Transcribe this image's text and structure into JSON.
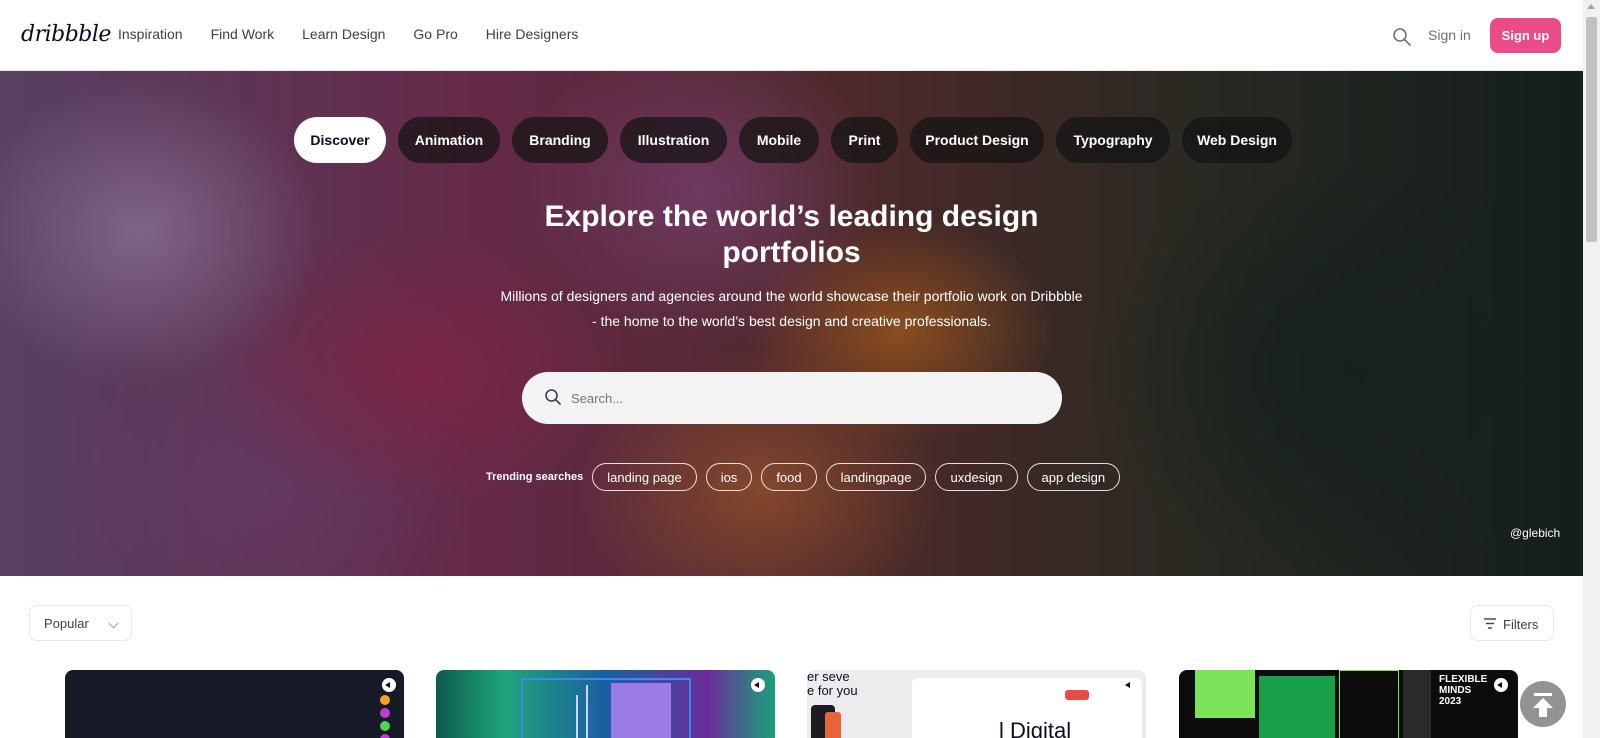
{
  "nav": {
    "logo": "dribbble",
    "links": [
      "Inspiration",
      "Find Work",
      "Learn Design",
      "Go Pro",
      "Hire Designers"
    ],
    "search_icon": "search-icon",
    "signin_label": "Sign in",
    "signup_label": "Sign up",
    "accent": "#ea4c89"
  },
  "hero": {
    "categories": [
      {
        "label": "Discover",
        "active": true
      },
      {
        "label": "Animation",
        "active": false
      },
      {
        "label": "Branding",
        "active": false
      },
      {
        "label": "Illustration",
        "active": false
      },
      {
        "label": "Mobile",
        "active": false
      },
      {
        "label": "Print",
        "active": false
      },
      {
        "label": "Product Design",
        "active": false
      },
      {
        "label": "Typography",
        "active": false
      },
      {
        "label": "Web Design",
        "active": false
      }
    ],
    "title_line1": "Explore the world’s leading design",
    "title_line2": "portfolios",
    "subtitle": "Millions of designers and agencies around the world showcase their portfolio work on Dribbble - the home to the world’s best design and creative professionals.",
    "search": {
      "placeholder": "Search...",
      "value": ""
    },
    "trending_label": "Trending searches",
    "trending_tags": [
      "landing page",
      "ios",
      "food",
      "landingpage",
      "uxdesign",
      "app design"
    ],
    "credit": "@glebich"
  },
  "toolbar": {
    "sort_value": "Popular",
    "filters_label": "Filters",
    "filter_icon": "filter-icon"
  },
  "shots": [
    {
      "icon": "shot-badge-icon"
    },
    {
      "icon": "shot-badge-icon"
    },
    {
      "icon": "shot-badge-icon",
      "text_top": "er seve\ne for you",
      "text_big": "l Digital"
    },
    {
      "icon": "shot-badge-icon",
      "text_big": "FLEXIBLE\nMINDS\n2023"
    }
  ],
  "scroll_to_top_icon": "arrow-up-icon"
}
